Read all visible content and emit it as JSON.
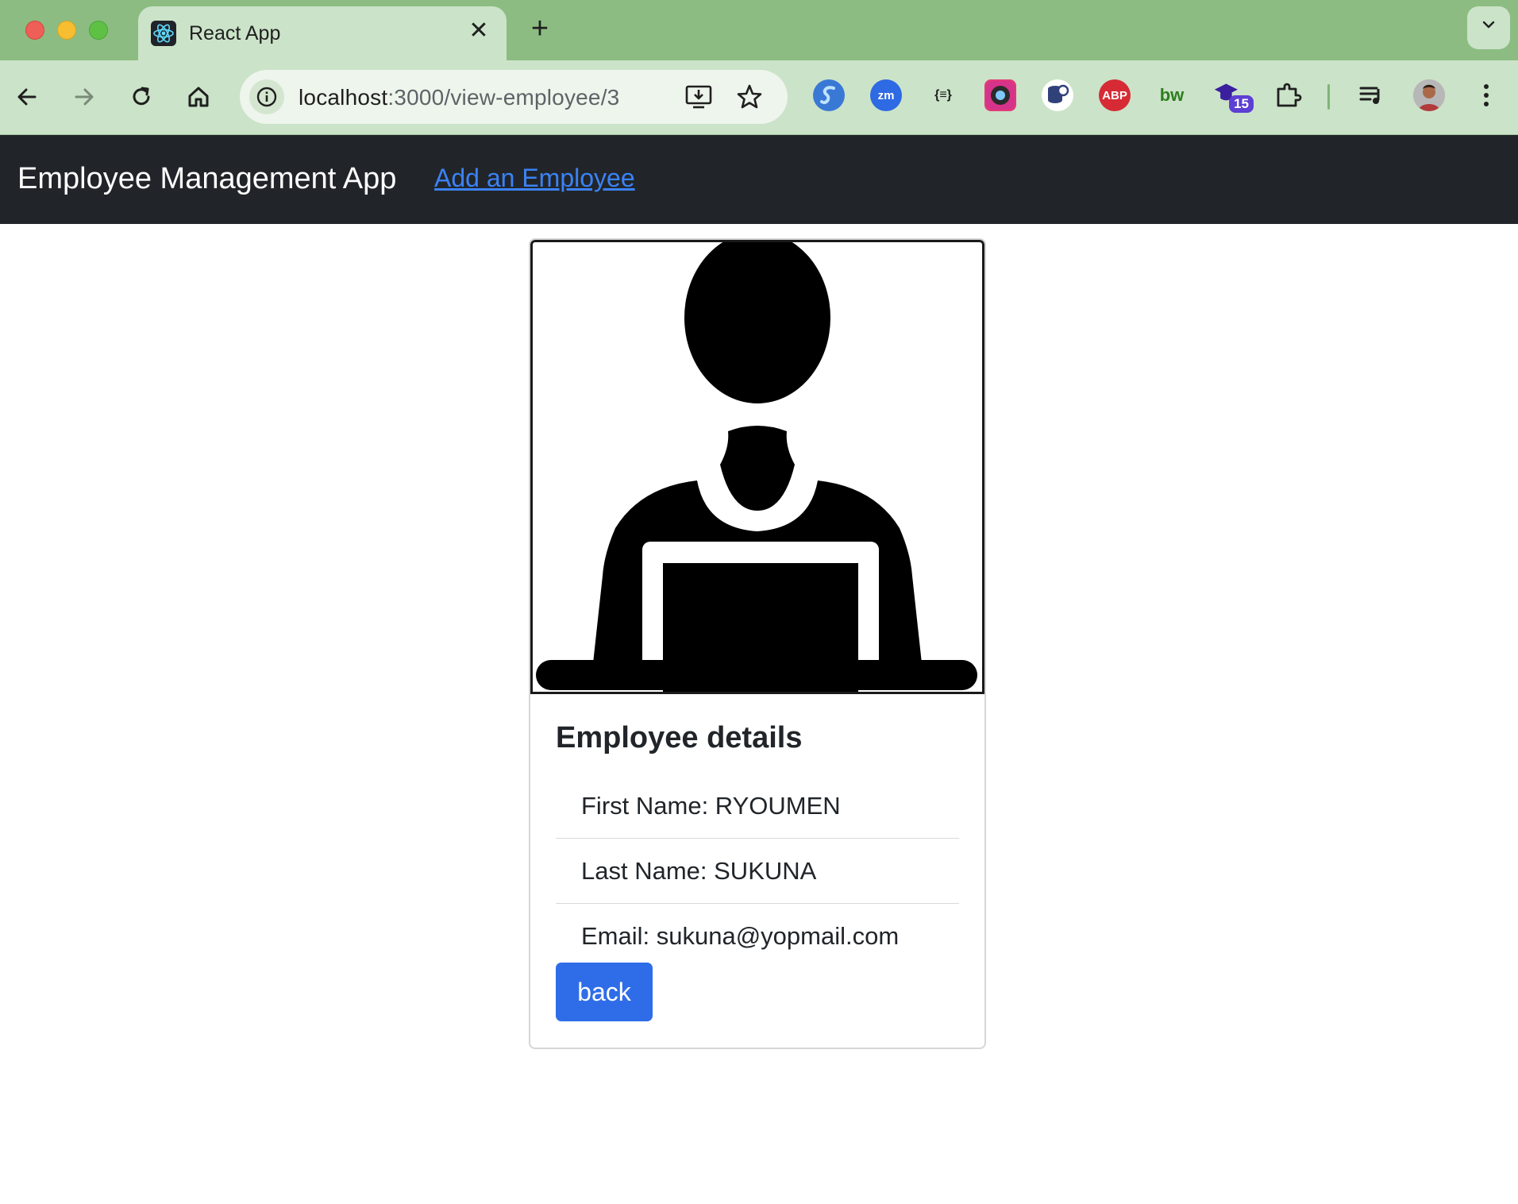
{
  "browser": {
    "tab_title": "React App",
    "tab_close": "✕",
    "new_tab": "+",
    "url_host": "localhost",
    "url_path": ":3000/view-employee/3",
    "extension_badge": "15",
    "extensions": [
      "S",
      "zm",
      "{≡}",
      "",
      "",
      "ABP",
      "bw",
      "",
      ""
    ]
  },
  "navbar": {
    "brand": "Employee Management App",
    "link": "Add an Employee"
  },
  "card": {
    "title": "Employee details",
    "details": [
      "First Name: RYOUMEN",
      "Last Name: SUKUNA",
      "Email: sukuna@yopmail.com"
    ],
    "back_label": "back"
  },
  "colors": {
    "tabstrip": "#8cbc82",
    "toolbar": "#cbe3c8",
    "navbar": "#212529",
    "link": "#3b82f6",
    "primary_button": "#2f6de8"
  }
}
